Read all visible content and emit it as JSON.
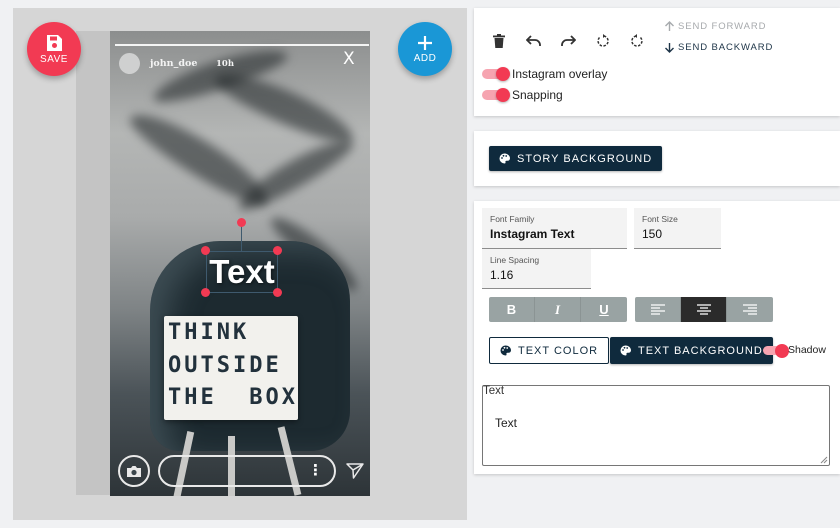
{
  "editor": {
    "save_label": "SAVE",
    "add_label": "ADD"
  },
  "story": {
    "username": "john_doe",
    "time": "10h",
    "close": "X",
    "overlay_text": "Text",
    "lightbox_lines": [
      "THINK",
      "OUTSIDE",
      "THE  BOX"
    ],
    "more_icon": "⋮"
  },
  "toolbar": {
    "icons": [
      "delete-icon",
      "undo-icon",
      "redo-icon",
      "rotate-left-icon",
      "rotate-right-icon"
    ],
    "send_forward": "SEND FORWARD",
    "send_backward": "SEND BACKWARD",
    "instagram_overlay": "Instagram overlay",
    "snapping": "Snapping",
    "instagram_overlay_on": true,
    "snapping_on": true
  },
  "background": {
    "button_label": "STORY BACKGROUND"
  },
  "text_props": {
    "font_family_label": "Font Family",
    "font_family_value": "Instagram Text",
    "font_size_label": "Font Size",
    "font_size_value": "150",
    "line_spacing_label": "Line Spacing",
    "line_spacing_value": "1.16",
    "style_buttons": [
      "B",
      "I",
      "U"
    ],
    "align_buttons": [
      "align-left-icon",
      "align-center-icon",
      "align-right-icon"
    ],
    "active_align": "align-center-icon",
    "text_color_label": "TEXT COLOR",
    "text_background_label": "TEXT BACKGROUND",
    "shadow_label": "Shadow",
    "shadow_on": true,
    "textarea_label": "Text",
    "textarea_value": "Text"
  },
  "colors": {
    "accent_red": "#f23a53",
    "accent_blue": "#1a97d6",
    "dark_navy": "#0f2a3d"
  }
}
